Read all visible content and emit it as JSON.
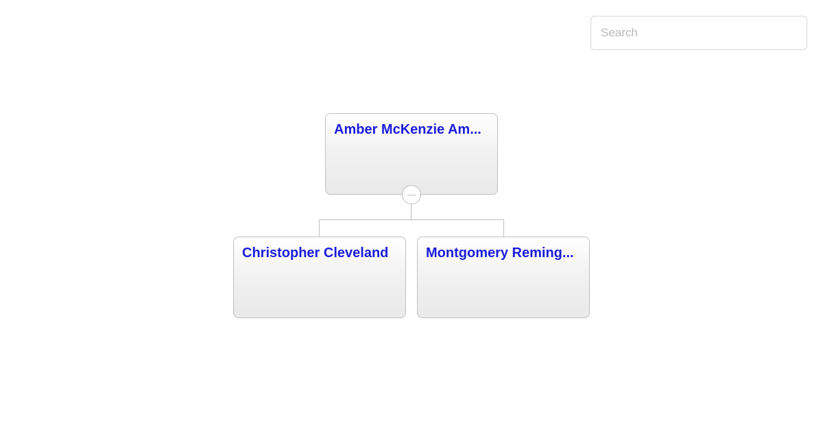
{
  "search": {
    "placeholder": "Search",
    "value": ""
  },
  "nodes": {
    "root": {
      "label": "Amber McKenzie Am..."
    },
    "child1": {
      "label": "Christopher Cleveland"
    },
    "child2": {
      "label": "Montgomery Reming..."
    }
  }
}
